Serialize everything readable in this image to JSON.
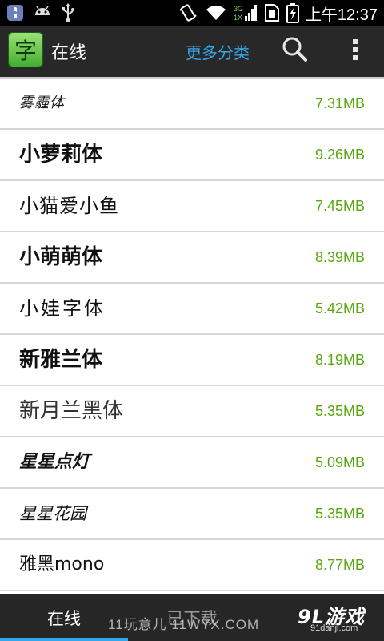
{
  "status_bar": {
    "time": "上午12:37",
    "network_label": "3G",
    "network_sub": "1X",
    "icons": [
      "usb-debug-icon",
      "android-icon",
      "usb-icon",
      "vibrate-icon",
      "wifi-icon",
      "signal-icon",
      "sim-icon",
      "battery-charging-icon"
    ]
  },
  "action_bar": {
    "title": "在线",
    "app_icon_glyph": "字",
    "more_categories": "更多分类",
    "search_icon": "search-icon",
    "overflow_icon": "overflow-menu-icon"
  },
  "fonts": [
    {
      "name": "雾霾体",
      "size": "7.31MB"
    },
    {
      "name": "小萝莉体",
      "size": "9.26MB"
    },
    {
      "name": "小猫爱小鱼",
      "size": "7.45MB"
    },
    {
      "name": "小萌萌体",
      "size": "8.39MB"
    },
    {
      "name": "小娃字体",
      "size": "5.42MB"
    },
    {
      "name": "新雅兰体",
      "size": "8.19MB"
    },
    {
      "name": "新月兰黑体",
      "size": "5.35MB"
    },
    {
      "name": "星星点灯",
      "size": "5.09MB"
    },
    {
      "name": "星星花园",
      "size": "5.35MB"
    },
    {
      "name": "雅黑mono",
      "size": "8.77MB"
    }
  ],
  "tabs": {
    "online": "在线",
    "downloaded": "已下载"
  },
  "watermark": {
    "left_text": "11玩意儿 11WYX.COM",
    "logo_text": "9L游戏",
    "logo_sub": "91danji.com"
  },
  "colors": {
    "accent": "#35a6e8",
    "size_green": "#57a80e",
    "action_bar": "#282828"
  }
}
